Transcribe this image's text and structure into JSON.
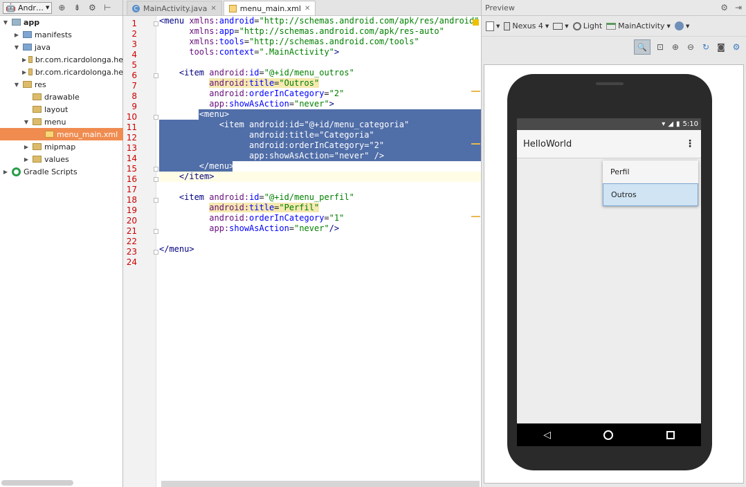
{
  "project_panel": {
    "view_label": "Andr…",
    "tree": [
      {
        "label": "app",
        "level": 0,
        "icon": "module-icon",
        "bold": true
      },
      {
        "label": "manifests",
        "level": 1,
        "icon": "folder-icon"
      },
      {
        "label": "java",
        "level": 1,
        "icon": "folder-icon"
      },
      {
        "label": "br.com.ricardolonga.he",
        "level": 2,
        "icon": "package-icon"
      },
      {
        "label": "br.com.ricardolonga.he",
        "level": 2,
        "icon": "package-icon"
      },
      {
        "label": "res",
        "level": 1,
        "icon": "folder-icon"
      },
      {
        "label": "drawable",
        "level": 2,
        "icon": "folder-icon"
      },
      {
        "label": "layout",
        "level": 2,
        "icon": "folder-icon"
      },
      {
        "label": "menu",
        "level": 2,
        "icon": "folder-icon"
      },
      {
        "label": "menu_main.xml",
        "level": 3,
        "icon": "xml-file-icon",
        "selected": true
      },
      {
        "label": "mipmap",
        "level": 2,
        "icon": "folder-icon"
      },
      {
        "label": "values",
        "level": 2,
        "icon": "folder-icon"
      },
      {
        "label": "Gradle Scripts",
        "level": 0,
        "icon": "gradle-icon"
      }
    ]
  },
  "editor": {
    "tabs": [
      {
        "label": "MainActivity.java",
        "active": false
      },
      {
        "label": "menu_main.xml",
        "active": true
      }
    ],
    "line_numbers": [
      "1",
      "2",
      "3",
      "4",
      "5",
      "6",
      "7",
      "8",
      "9",
      "10",
      "11",
      "12",
      "13",
      "14",
      "15",
      "16",
      "17",
      "18",
      "19",
      "20",
      "21",
      "22",
      "23",
      "24"
    ]
  },
  "preview": {
    "title": "Preview",
    "device": "Nexus 4",
    "theme": "Light",
    "activity": "MainActivity",
    "phone": {
      "time": "5:10",
      "app_title": "HelloWorld",
      "menu_items": [
        "Perfil",
        "Outros"
      ]
    }
  }
}
